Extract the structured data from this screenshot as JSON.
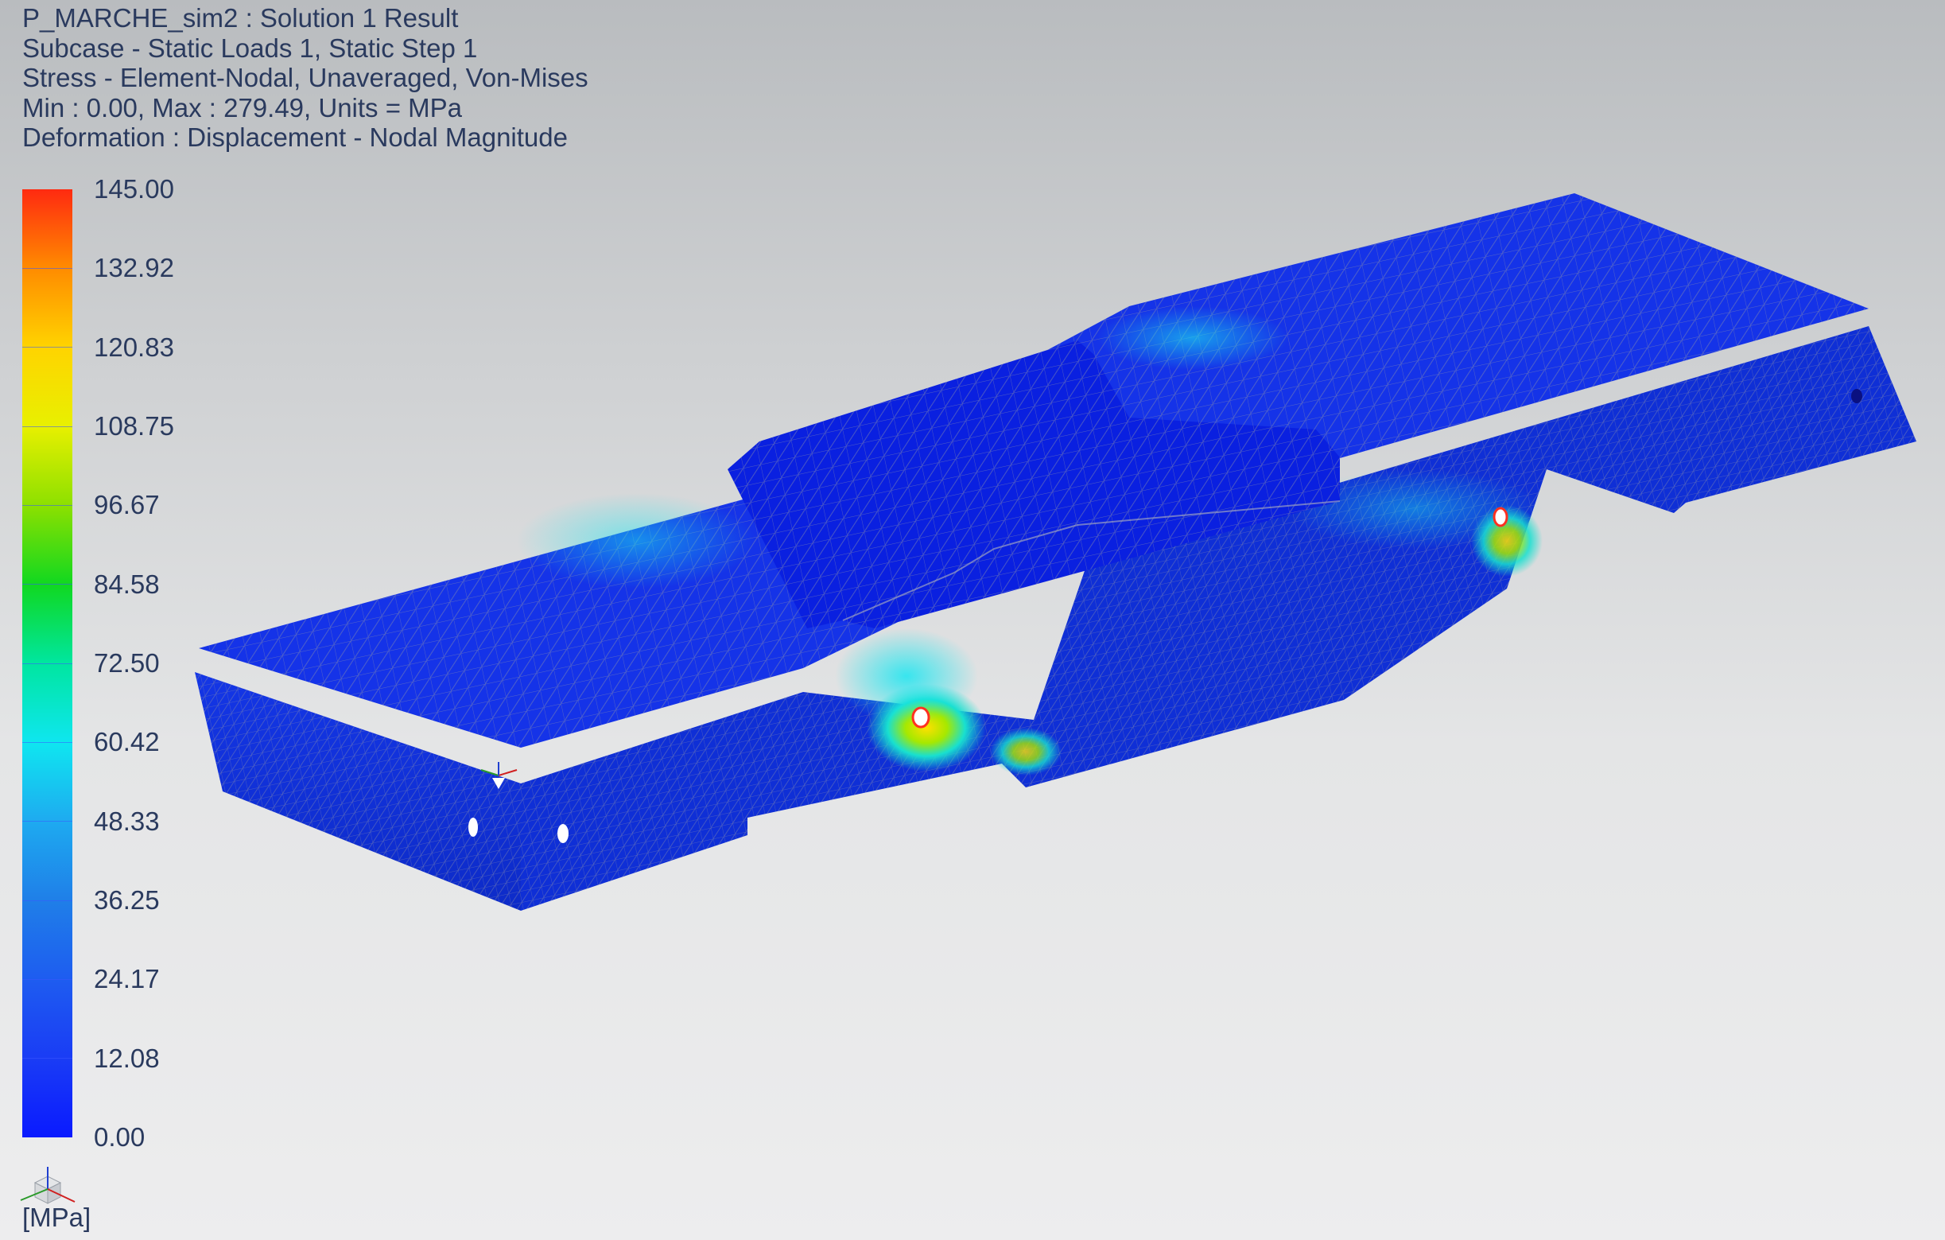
{
  "header": {
    "line1": "P_MARCHE_sim2 : Solution 1 Result",
    "line2": "Subcase - Static Loads 1, Static Step 1",
    "line3": "Stress - Element-Nodal, Unaveraged, Von-Mises",
    "line4": "Min : 0.00, Max : 279.49, Units = MPa",
    "line5": "Deformation : Displacement - Nodal Magnitude"
  },
  "legend": {
    "labels": [
      "145.00",
      "132.92",
      "120.83",
      "108.75",
      "96.67",
      "84.58",
      "72.50",
      "60.42",
      "48.33",
      "36.25",
      "24.17",
      "12.08",
      "0.00"
    ],
    "units": "[MPa]",
    "color_min": "#0a1aff",
    "color_max": "#ff2a10"
  },
  "model": {
    "base_color": "#1436e6",
    "mesh_color": "#8a8fa8"
  }
}
